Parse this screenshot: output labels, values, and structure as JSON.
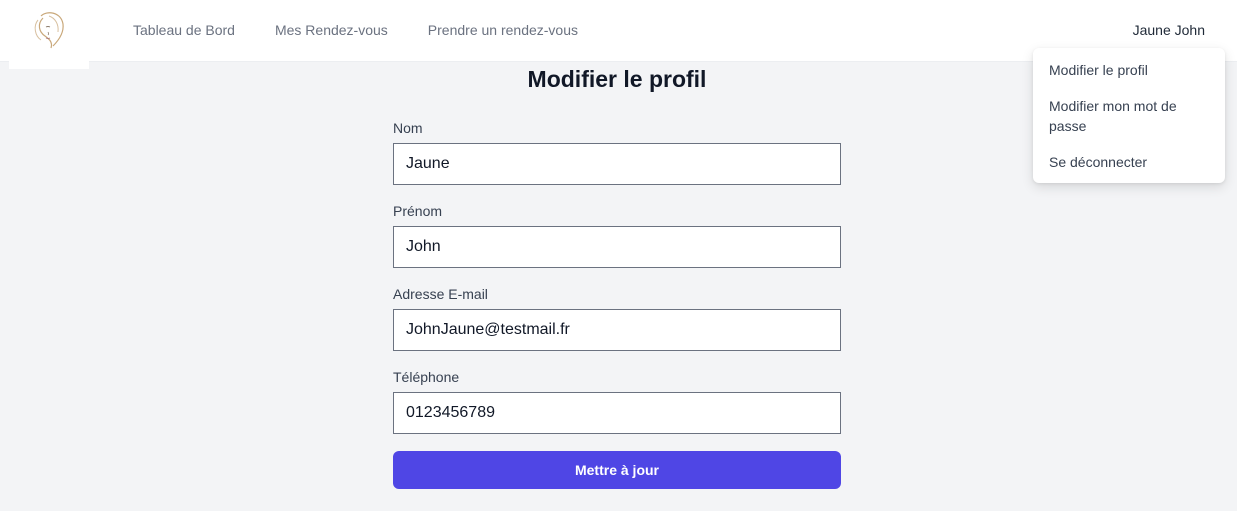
{
  "nav": {
    "logo_icon": "woman-face-logo-icon",
    "links": [
      {
        "label": "Tableau de Bord"
      },
      {
        "label": "Mes Rendez-vous"
      },
      {
        "label": "Prendre un rendez-vous"
      }
    ],
    "user_name": "Jaune John"
  },
  "user_menu": {
    "items": [
      {
        "label": "Modifier le profil"
      },
      {
        "label": "Modifier mon mot de passe"
      },
      {
        "label": "Se déconnecter"
      }
    ]
  },
  "page": {
    "title": "Modifier le profil"
  },
  "form": {
    "nom": {
      "label": "Nom",
      "value": "Jaune"
    },
    "prenom": {
      "label": "Prénom",
      "value": "John"
    },
    "email": {
      "label": "Adresse E-mail",
      "value": "JohnJaune@testmail.fr"
    },
    "telephone": {
      "label": "Téléphone",
      "value": "0123456789"
    },
    "submit_label": "Mettre à jour"
  },
  "colors": {
    "accent": "#4f46e5",
    "background": "#f3f4f6",
    "navbar": "#ffffff"
  }
}
